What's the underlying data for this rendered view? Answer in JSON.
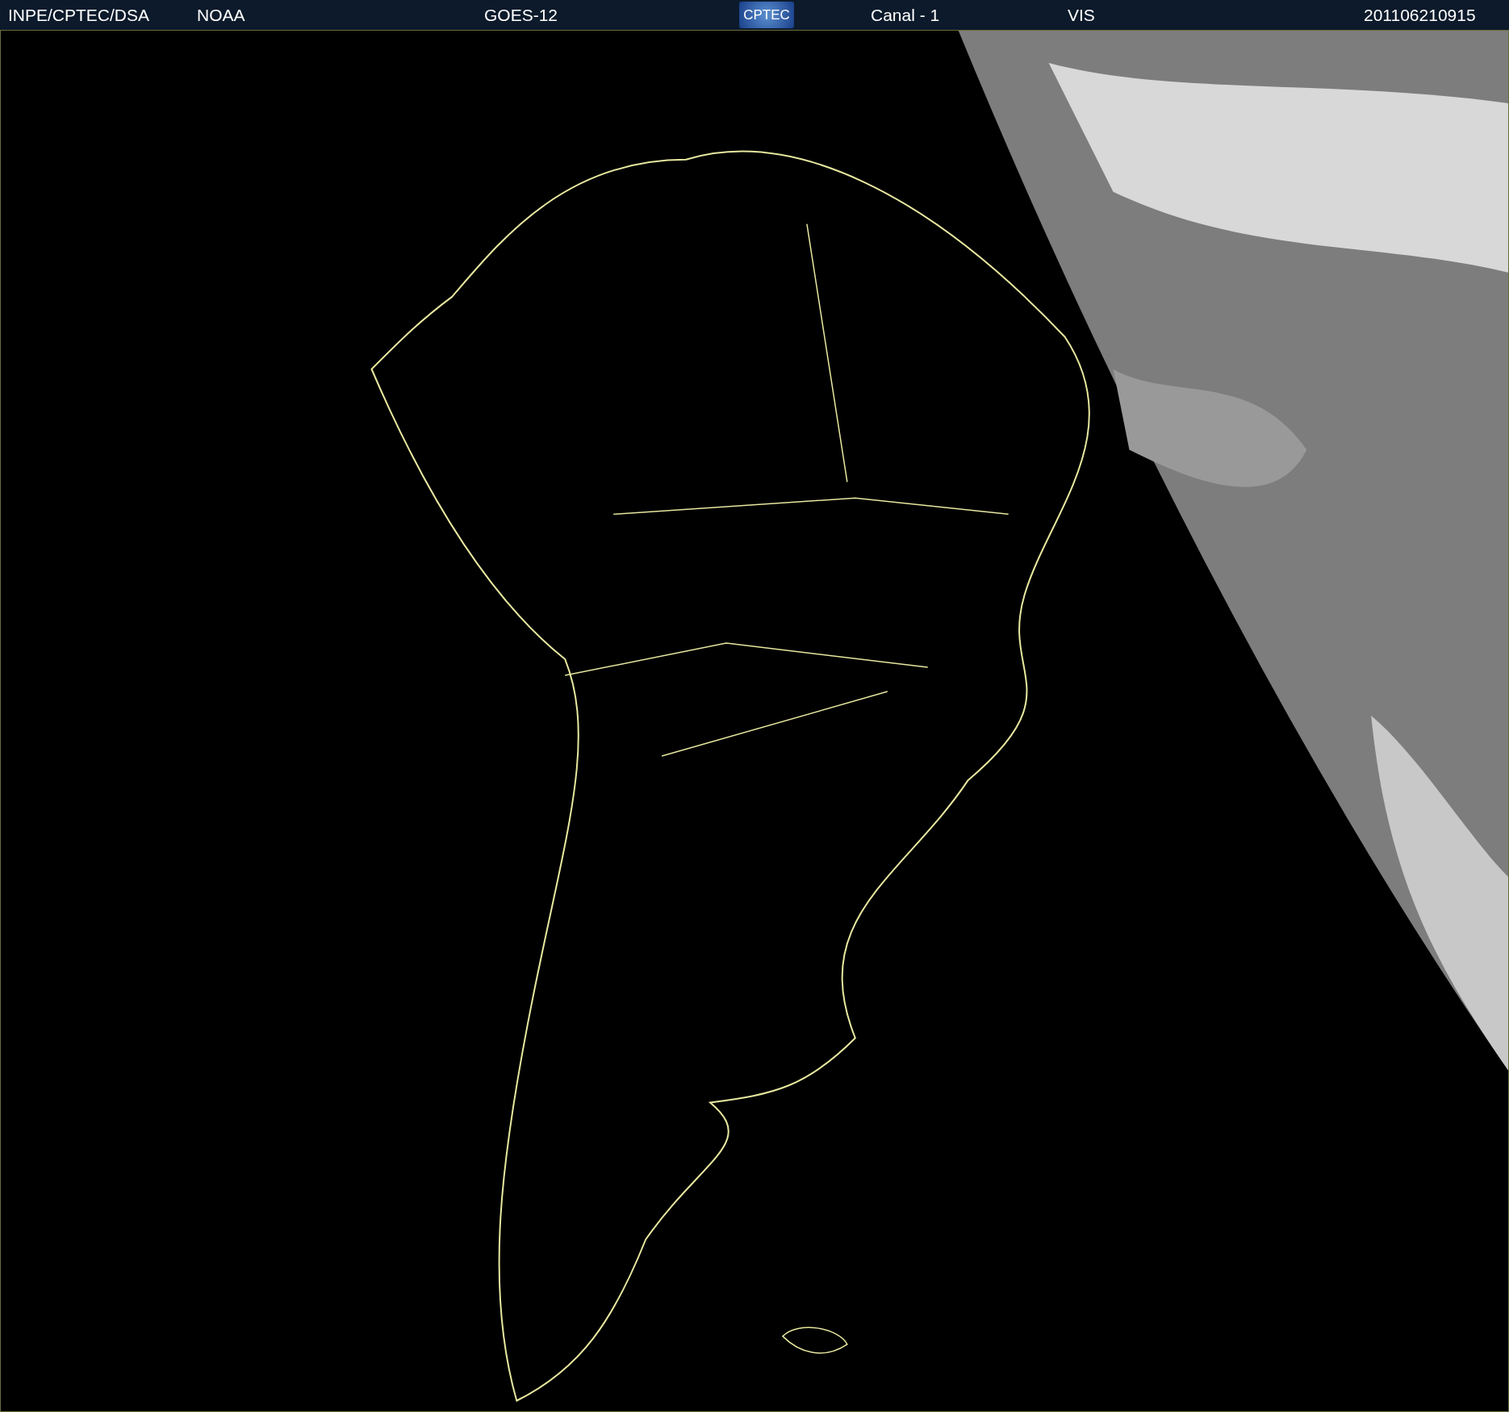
{
  "header": {
    "items": [
      {
        "kind": "text",
        "text": "INPE/CPTEC/DSA"
      },
      {
        "kind": "text",
        "text": "NOAA"
      },
      {
        "kind": "text",
        "text": "GOES-12"
      },
      {
        "kind": "logo",
        "text": "CPTEC"
      },
      {
        "kind": "text",
        "text": "Canal - 1"
      },
      {
        "kind": "text",
        "text": "VIS"
      },
      {
        "kind": "text",
        "text": "201106210915"
      }
    ]
  }
}
